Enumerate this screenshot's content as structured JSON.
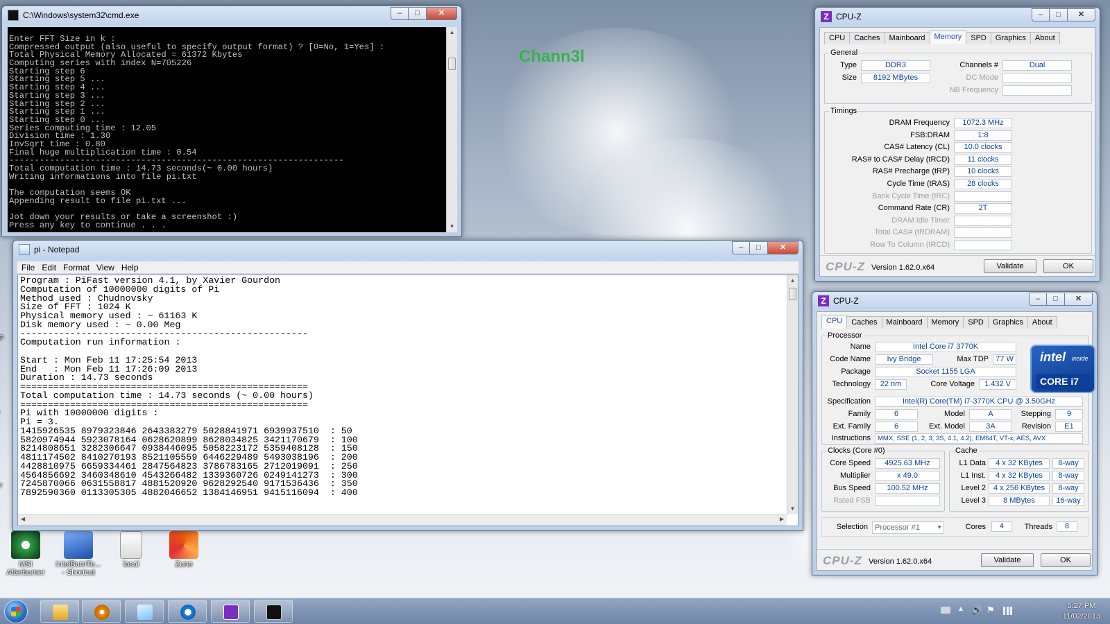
{
  "desktop": {
    "watermark": "Chann3l",
    "icons": [
      {
        "label": "MSI Afterburner"
      },
      {
        "label": "IntelBurnTe... - Shortcut"
      },
      {
        "label": "local"
      },
      {
        "label": "Zune"
      }
    ],
    "edge_letters": [
      "A",
      "CP",
      "Te",
      "Liv"
    ]
  },
  "cmd": {
    "title": "C:\\Windows\\system32\\cmd.exe",
    "lines": [
      "Enter FFT Size in k :",
      "Compressed output (also useful to specify output format) ? [0=No, 1=Yes] :",
      "Total Physical Memory Allocated = 61372 Kbytes",
      "Computing series with index N=705226",
      "Starting step 6",
      "Starting step 5 ...",
      "Starting step 4 ...",
      "Starting step 3 ...",
      "Starting step 2 ...",
      "Starting step 1 ...",
      "Starting step 0 ...",
      "Series computing time : 12.05",
      "Division time : 1.30",
      "InvSqrt time : 0.80",
      "Final huge multiplication time : 0.54",
      "------------------------------------------------------------------",
      "Total computation time : 14.73 seconds(~ 0.00 hours)",
      "Writing informations into file pi.txt",
      "",
      "The computation seems OK",
      "Appending result to file pi.txt ...",
      "",
      "Jot down your results or take a screenshot :)",
      "Press any key to continue . . ."
    ]
  },
  "notepad": {
    "title": "pi - Notepad",
    "menu": [
      "File",
      "Edit",
      "Format",
      "View",
      "Help"
    ],
    "lines": [
      "Program : PiFast version 4.1, by Xavier Gourdon",
      "Computation of 10000000 digits of Pi",
      "Method used : Chudnovsky",
      "Size of FFT : 1024 K",
      "Physical memory used : ~ 61163 K",
      "Disk memory used : ~ 0.00 Meg",
      "----------------------------------------------------",
      "Computation run information :",
      "",
      "Start : Mon Feb 11 17:25:54 2013",
      "End   : Mon Feb 11 17:26:09 2013",
      "Duration : 14.73 seconds",
      "====================================================",
      "Total computation time : 14.73 seconds (~ 0.00 hours)",
      "====================================================",
      "Pi with 10000000 digits :",
      "Pi = 3.",
      "1415926535 8979323846 2643383279 5028841971 6939937510  : 50",
      "5820974944 5923078164 0628620899 8628034825 3421170679  : 100",
      "8214808651 3282306647 0938446095 5058223172 5359408128  : 150",
      "4811174502 8410270193 8521105559 6446229489 5493038196  : 200",
      "4428810975 6659334461 2847564823 3786783165 2712019091  : 250",
      "4564856692 3460348610 4543266482 1339360726 0249141273  : 300",
      "7245870066 0631558817 4881520920 9628292540 9171536436  : 350",
      "7892590360 0113305305 4882046652 1384146951 9415116094  : 400"
    ]
  },
  "cpuz_memory": {
    "title": "CPU-Z",
    "tabs": [
      "CPU",
      "Caches",
      "Mainboard",
      "Memory",
      "SPD",
      "Graphics",
      "About"
    ],
    "active_tab": "Memory",
    "general_label": "General",
    "type_label": "Type",
    "type": "DDR3",
    "size_label": "Size",
    "size": "8192 MBytes",
    "channels_label": "Channels #",
    "channels": "Dual",
    "dc_mode_label": "DC Mode",
    "nb_freq_label": "NB Frequency",
    "timings_label": "Timings",
    "timings": [
      {
        "label": "DRAM Frequency",
        "value": "1072.3 MHz",
        "dim": false
      },
      {
        "label": "FSB:DRAM",
        "value": "1:8",
        "dim": false
      },
      {
        "label": "CAS# Latency (CL)",
        "value": "10.0 clocks",
        "dim": false
      },
      {
        "label": "RAS# to CAS# Delay (tRCD)",
        "value": "11 clocks",
        "dim": false
      },
      {
        "label": "RAS# Precharge (tRP)",
        "value": "10 clocks",
        "dim": false
      },
      {
        "label": "Cycle Time (tRAS)",
        "value": "28 clocks",
        "dim": false
      },
      {
        "label": "Bank Cycle Time (tRC)",
        "value": "",
        "dim": true
      },
      {
        "label": "Command Rate (CR)",
        "value": "2T",
        "dim": false
      },
      {
        "label": "DRAM Idle Timer",
        "value": "",
        "dim": true
      },
      {
        "label": "Total CAS# (tRDRAM)",
        "value": "",
        "dim": true
      },
      {
        "label": "Row To Column (tRCD)",
        "value": "",
        "dim": true
      }
    ],
    "logo": "CPU-Z",
    "version": "Version 1.62.0.x64",
    "validate": "Validate",
    "ok": "OK"
  },
  "cpuz_cpu": {
    "title": "CPU-Z",
    "tabs": [
      "CPU",
      "Caches",
      "Mainboard",
      "Memory",
      "SPD",
      "Graphics",
      "About"
    ],
    "active_tab": "CPU",
    "processor_label": "Processor",
    "name_label": "Name",
    "name": "Intel Core i7 3770K",
    "codename_label": "Code Name",
    "codename": "Ivy Bridge",
    "maxtdp_label": "Max TDP",
    "maxtdp": "77 W",
    "package_label": "Package",
    "package": "Socket 1155 LGA",
    "technology_label": "Technology",
    "technology": "22 nm",
    "corevoltage_label": "Core Voltage",
    "corevoltage": "1.432 V",
    "spec_label": "Specification",
    "spec": "Intel(R) Core(TM) i7-3770K CPU @ 3.50GHz",
    "family_label": "Family",
    "family": "6",
    "model_label": "Model",
    "model": "A",
    "stepping_label": "Stepping",
    "stepping": "9",
    "extfamily_label": "Ext. Family",
    "extfamily": "6",
    "extmodel_label": "Ext. Model",
    "extmodel": "3A",
    "revision_label": "Revision",
    "revision": "E1",
    "instr_label": "Instructions",
    "instr": "MMX, SSE (1, 2, 3, 3S, 4.1, 4.2), EM64T, VT-x, AES, AVX",
    "intel_inside": "intel",
    "intel_inside_small": "inside",
    "intel_brand": "CORE i7",
    "clocks_label": "Clocks (Core #0)",
    "corespeed_label": "Core Speed",
    "corespeed": "4925.63 MHz",
    "multiplier_label": "Multiplier",
    "multiplier": "x 49.0",
    "busspeed_label": "Bus Speed",
    "busspeed": "100.52 MHz",
    "ratedfsb_label": "Rated FSB",
    "cache_label": "Cache",
    "caches": [
      {
        "label": "L1 Data",
        "size": "4 x 32 KBytes",
        "way": "8-way"
      },
      {
        "label": "L1 Inst.",
        "size": "4 x 32 KBytes",
        "way": "8-way"
      },
      {
        "label": "Level 2",
        "size": "4 x 256 KBytes",
        "way": "8-way"
      },
      {
        "label": "Level 3",
        "size": "8 MBytes",
        "way": "16-way"
      }
    ],
    "selection_label": "Selection",
    "selection": "Processor #1",
    "cores_label": "Cores",
    "cores": "4",
    "threads_label": "Threads",
    "threads": "8",
    "logo": "CPU-Z",
    "version": "Version 1.62.0.x64",
    "validate": "Validate",
    "ok": "OK"
  },
  "taskbar": {
    "clock_time": "5:27 PM",
    "clock_date": "11/02/2013"
  },
  "colors": {
    "tab_active": "#1e4fc8",
    "value_text": "#0a3fa0",
    "watermark": "#37b24d"
  }
}
